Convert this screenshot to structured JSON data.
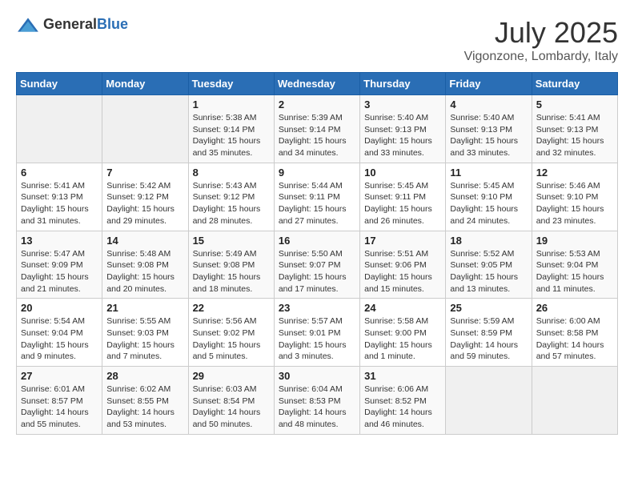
{
  "header": {
    "logo_general": "General",
    "logo_blue": "Blue",
    "month_year": "July 2025",
    "location": "Vigonzone, Lombardy, Italy"
  },
  "weekdays": [
    "Sunday",
    "Monday",
    "Tuesday",
    "Wednesday",
    "Thursday",
    "Friday",
    "Saturday"
  ],
  "weeks": [
    [
      {
        "day": "",
        "sunrise": "",
        "sunset": "",
        "daylight": ""
      },
      {
        "day": "",
        "sunrise": "",
        "sunset": "",
        "daylight": ""
      },
      {
        "day": "1",
        "sunrise": "Sunrise: 5:38 AM",
        "sunset": "Sunset: 9:14 PM",
        "daylight": "Daylight: 15 hours and 35 minutes."
      },
      {
        "day": "2",
        "sunrise": "Sunrise: 5:39 AM",
        "sunset": "Sunset: 9:14 PM",
        "daylight": "Daylight: 15 hours and 34 minutes."
      },
      {
        "day": "3",
        "sunrise": "Sunrise: 5:40 AM",
        "sunset": "Sunset: 9:13 PM",
        "daylight": "Daylight: 15 hours and 33 minutes."
      },
      {
        "day": "4",
        "sunrise": "Sunrise: 5:40 AM",
        "sunset": "Sunset: 9:13 PM",
        "daylight": "Daylight: 15 hours and 33 minutes."
      },
      {
        "day": "5",
        "sunrise": "Sunrise: 5:41 AM",
        "sunset": "Sunset: 9:13 PM",
        "daylight": "Daylight: 15 hours and 32 minutes."
      }
    ],
    [
      {
        "day": "6",
        "sunrise": "Sunrise: 5:41 AM",
        "sunset": "Sunset: 9:13 PM",
        "daylight": "Daylight: 15 hours and 31 minutes."
      },
      {
        "day": "7",
        "sunrise": "Sunrise: 5:42 AM",
        "sunset": "Sunset: 9:12 PM",
        "daylight": "Daylight: 15 hours and 29 minutes."
      },
      {
        "day": "8",
        "sunrise": "Sunrise: 5:43 AM",
        "sunset": "Sunset: 9:12 PM",
        "daylight": "Daylight: 15 hours and 28 minutes."
      },
      {
        "day": "9",
        "sunrise": "Sunrise: 5:44 AM",
        "sunset": "Sunset: 9:11 PM",
        "daylight": "Daylight: 15 hours and 27 minutes."
      },
      {
        "day": "10",
        "sunrise": "Sunrise: 5:45 AM",
        "sunset": "Sunset: 9:11 PM",
        "daylight": "Daylight: 15 hours and 26 minutes."
      },
      {
        "day": "11",
        "sunrise": "Sunrise: 5:45 AM",
        "sunset": "Sunset: 9:10 PM",
        "daylight": "Daylight: 15 hours and 24 minutes."
      },
      {
        "day": "12",
        "sunrise": "Sunrise: 5:46 AM",
        "sunset": "Sunset: 9:10 PM",
        "daylight": "Daylight: 15 hours and 23 minutes."
      }
    ],
    [
      {
        "day": "13",
        "sunrise": "Sunrise: 5:47 AM",
        "sunset": "Sunset: 9:09 PM",
        "daylight": "Daylight: 15 hours and 21 minutes."
      },
      {
        "day": "14",
        "sunrise": "Sunrise: 5:48 AM",
        "sunset": "Sunset: 9:08 PM",
        "daylight": "Daylight: 15 hours and 20 minutes."
      },
      {
        "day": "15",
        "sunrise": "Sunrise: 5:49 AM",
        "sunset": "Sunset: 9:08 PM",
        "daylight": "Daylight: 15 hours and 18 minutes."
      },
      {
        "day": "16",
        "sunrise": "Sunrise: 5:50 AM",
        "sunset": "Sunset: 9:07 PM",
        "daylight": "Daylight: 15 hours and 17 minutes."
      },
      {
        "day": "17",
        "sunrise": "Sunrise: 5:51 AM",
        "sunset": "Sunset: 9:06 PM",
        "daylight": "Daylight: 15 hours and 15 minutes."
      },
      {
        "day": "18",
        "sunrise": "Sunrise: 5:52 AM",
        "sunset": "Sunset: 9:05 PM",
        "daylight": "Daylight: 15 hours and 13 minutes."
      },
      {
        "day": "19",
        "sunrise": "Sunrise: 5:53 AM",
        "sunset": "Sunset: 9:04 PM",
        "daylight": "Daylight: 15 hours and 11 minutes."
      }
    ],
    [
      {
        "day": "20",
        "sunrise": "Sunrise: 5:54 AM",
        "sunset": "Sunset: 9:04 PM",
        "daylight": "Daylight: 15 hours and 9 minutes."
      },
      {
        "day": "21",
        "sunrise": "Sunrise: 5:55 AM",
        "sunset": "Sunset: 9:03 PM",
        "daylight": "Daylight: 15 hours and 7 minutes."
      },
      {
        "day": "22",
        "sunrise": "Sunrise: 5:56 AM",
        "sunset": "Sunset: 9:02 PM",
        "daylight": "Daylight: 15 hours and 5 minutes."
      },
      {
        "day": "23",
        "sunrise": "Sunrise: 5:57 AM",
        "sunset": "Sunset: 9:01 PM",
        "daylight": "Daylight: 15 hours and 3 minutes."
      },
      {
        "day": "24",
        "sunrise": "Sunrise: 5:58 AM",
        "sunset": "Sunset: 9:00 PM",
        "daylight": "Daylight: 15 hours and 1 minute."
      },
      {
        "day": "25",
        "sunrise": "Sunrise: 5:59 AM",
        "sunset": "Sunset: 8:59 PM",
        "daylight": "Daylight: 14 hours and 59 minutes."
      },
      {
        "day": "26",
        "sunrise": "Sunrise: 6:00 AM",
        "sunset": "Sunset: 8:58 PM",
        "daylight": "Daylight: 14 hours and 57 minutes."
      }
    ],
    [
      {
        "day": "27",
        "sunrise": "Sunrise: 6:01 AM",
        "sunset": "Sunset: 8:57 PM",
        "daylight": "Daylight: 14 hours and 55 minutes."
      },
      {
        "day": "28",
        "sunrise": "Sunrise: 6:02 AM",
        "sunset": "Sunset: 8:55 PM",
        "daylight": "Daylight: 14 hours and 53 minutes."
      },
      {
        "day": "29",
        "sunrise": "Sunrise: 6:03 AM",
        "sunset": "Sunset: 8:54 PM",
        "daylight": "Daylight: 14 hours and 50 minutes."
      },
      {
        "day": "30",
        "sunrise": "Sunrise: 6:04 AM",
        "sunset": "Sunset: 8:53 PM",
        "daylight": "Daylight: 14 hours and 48 minutes."
      },
      {
        "day": "31",
        "sunrise": "Sunrise: 6:06 AM",
        "sunset": "Sunset: 8:52 PM",
        "daylight": "Daylight: 14 hours and 46 minutes."
      },
      {
        "day": "",
        "sunrise": "",
        "sunset": "",
        "daylight": ""
      },
      {
        "day": "",
        "sunrise": "",
        "sunset": "",
        "daylight": ""
      }
    ]
  ]
}
